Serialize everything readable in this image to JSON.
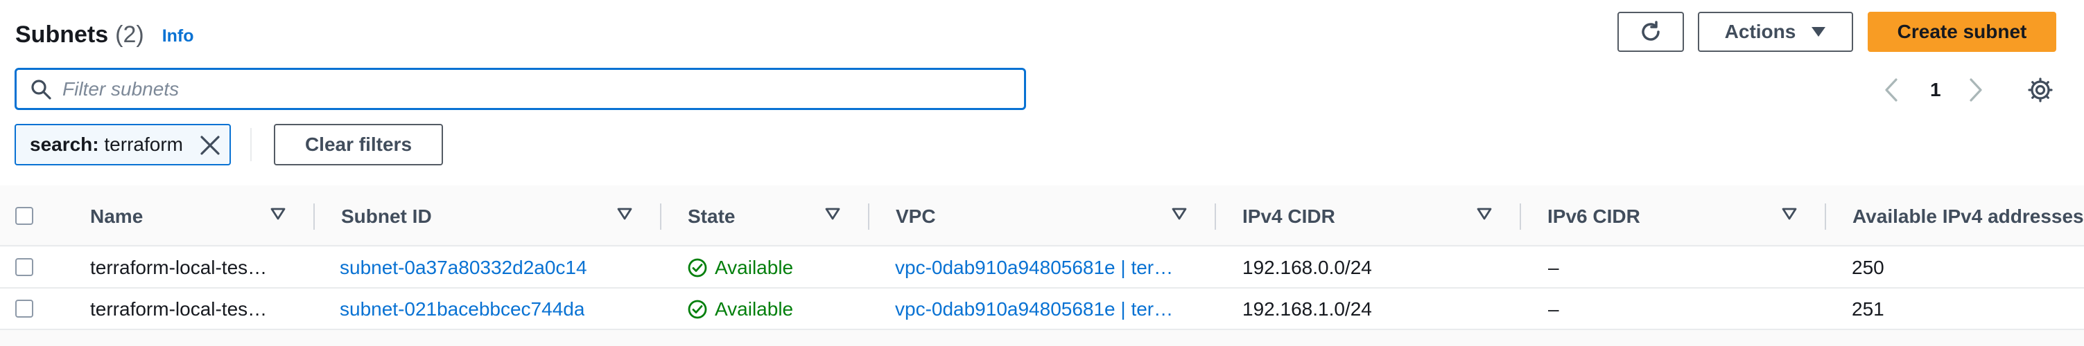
{
  "header": {
    "title": "Subnets",
    "count": "(2)",
    "info": "Info"
  },
  "toolbar": {
    "actions_label": "Actions",
    "create_label": "Create subnet"
  },
  "filter": {
    "placeholder": "Filter subnets",
    "value": ""
  },
  "pagination": {
    "current_page": "1"
  },
  "token": {
    "key": "search:",
    "value": "terraform"
  },
  "clear_filters_label": "Clear filters",
  "table": {
    "columns": [
      "Name",
      "Subnet ID",
      "State",
      "VPC",
      "IPv4 CIDR",
      "IPv6 CIDR",
      "Available IPv4 addresses"
    ],
    "rows": [
      {
        "name": "terraform-local-tes…",
        "subnet_id": "subnet-0a37a80332d2a0c14",
        "state": "Available",
        "vpc": "vpc-0dab910a94805681e | ter…",
        "ipv4_cidr": "192.168.0.0/24",
        "ipv6_cidr": "–",
        "available_ipv4": "250"
      },
      {
        "name": "terraform-local-tes…",
        "subnet_id": "subnet-021bacebbcec744da",
        "state": "Available",
        "vpc": "vpc-0dab910a94805681e | ter…",
        "ipv4_cidr": "192.168.1.0/24",
        "ipv6_cidr": "–",
        "available_ipv4": "251"
      }
    ]
  },
  "colors": {
    "primary": "#f89c24",
    "link": "#0972d3",
    "success": "#037f0c",
    "border": "#545b64"
  },
  "icons": {
    "search": "search-icon",
    "refresh": "refresh-icon",
    "caret": "caret-down-icon",
    "close": "close-icon",
    "prev": "chevron-left-icon",
    "next": "chevron-right-icon",
    "settings": "gear-icon",
    "sort": "sort-caret-icon",
    "status": "check-circle-icon"
  }
}
